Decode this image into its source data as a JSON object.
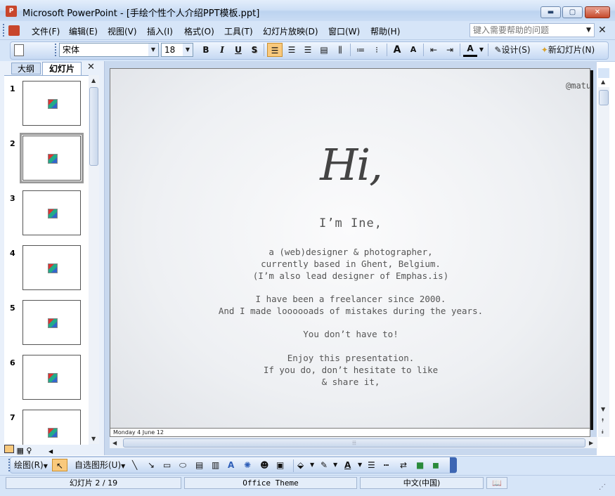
{
  "window": {
    "app_icon_text": "P",
    "title": "Microsoft PowerPoint - [手绘个性个人介绍PPT模板.ppt]",
    "minimize": "▬",
    "maximize": "▢",
    "close": "✕"
  },
  "menu": {
    "items": [
      "文件(F)",
      "编辑(E)",
      "视图(V)",
      "插入(I)",
      "格式(O)",
      "工具(T)",
      "幻灯片放映(D)",
      "窗口(W)",
      "帮助(H)"
    ],
    "help_placeholder": "键入需要帮助的问题",
    "close_glyph": "✕"
  },
  "toolbar": {
    "font_name": "宋体",
    "font_size": "18",
    "bold": "B",
    "italic": "I",
    "underline": "U",
    "shadow": "S",
    "grow_font": "A",
    "shrink_font": "A",
    "font_color": "A",
    "design_label": "设计(S)",
    "new_slide_label": "新幻灯片(N)"
  },
  "panel": {
    "tab_outline": "大纲",
    "tab_slides": "幻灯片",
    "close_glyph": "✕",
    "slide_numbers": [
      "1",
      "2",
      "3",
      "4",
      "5",
      "6",
      "7"
    ],
    "selected_slide": 2
  },
  "slide": {
    "handle": "@matuvu",
    "greeting": "Hi,",
    "intro": "I’m Ine,",
    "para1": [
      "a (web)designer & photographer,",
      "currently based in Ghent, Belgium.",
      "(I’m also lead designer of Emphas.is)"
    ],
    "para2": [
      "I have been a freelancer since 2000.",
      "And I made loooooads of mistakes during the years."
    ],
    "para3": [
      "You don’t have to!"
    ],
    "para4": [
      "Enjoy this presentation.",
      "If you do, don’t hesitate to like",
      "& share it,"
    ],
    "footer_date": "Monday 4 June 12"
  },
  "drawbar": {
    "draw_label": "绘图(R)",
    "autoshapes_label": "自选图形(U)"
  },
  "status": {
    "slide_position": "幻灯片 2 / 19",
    "theme": "Office Theme",
    "language": "中文(中国)"
  },
  "colors": {
    "active_button": "#f9c97c",
    "chrome": "#d6e5f8",
    "slide_text": "#555555"
  }
}
